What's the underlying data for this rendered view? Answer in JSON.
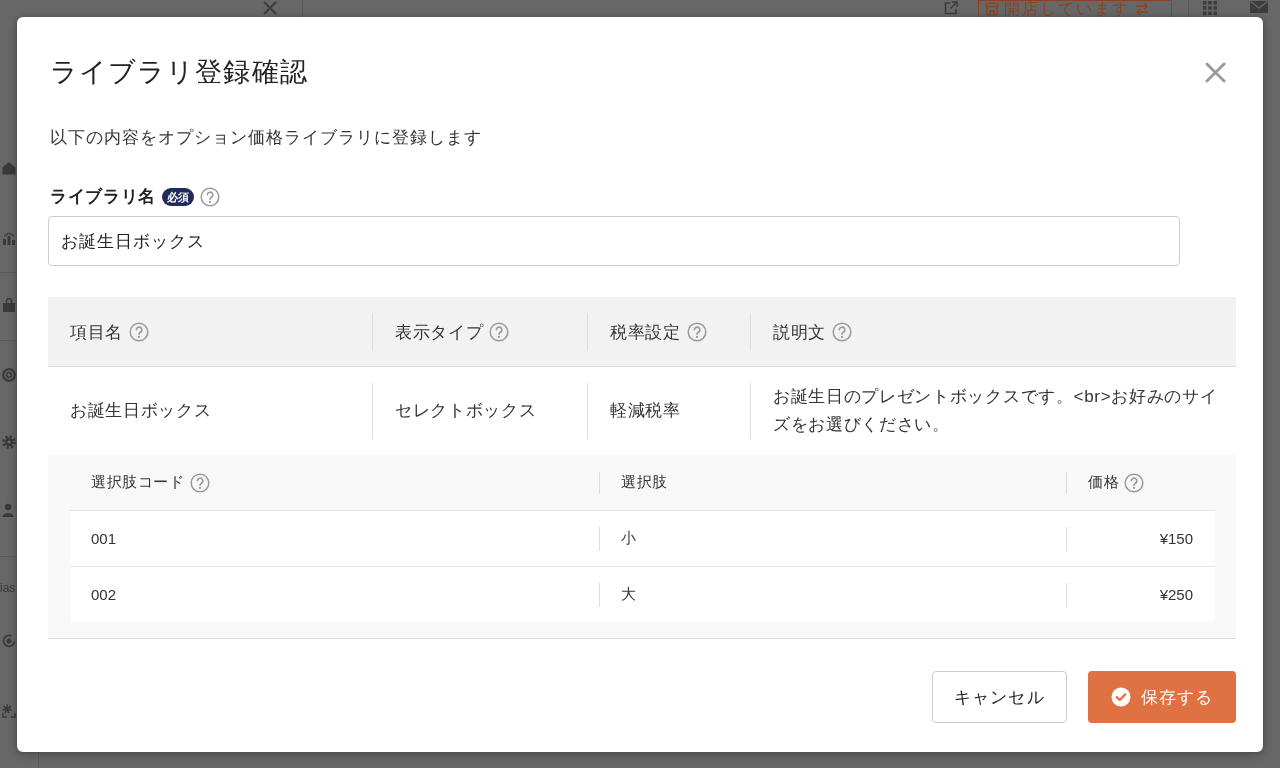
{
  "background_app": {
    "store_status_button": "開店しています",
    "sidebar_text": "ias"
  },
  "dialog": {
    "title": "ライブラリ登録確認",
    "description": "以下の内容をオプション価格ライブラリに登録します",
    "library_name_field": {
      "label": "ライブラリ名",
      "badge": "必須",
      "help": true,
      "value": "お誕生日ボックス"
    },
    "item_table": {
      "columns": [
        {
          "label": "項目名",
          "help": true
        },
        {
          "label": "表示タイプ",
          "help": true
        },
        {
          "label": "税率設定",
          "help": true
        },
        {
          "label": "説明文",
          "help": true
        }
      ],
      "rows": [
        [
          "お誕生日ボックス",
          "セレクトボックス",
          "軽減税率",
          "お誕生日のプレゼントボックスです。<br>お好みのサイズをお選びください。"
        ]
      ]
    },
    "options_table": {
      "columns": [
        {
          "label": "選択肢コード",
          "help": true,
          "kind": "text"
        },
        {
          "label": "選択肢",
          "help": false,
          "kind": "text"
        },
        {
          "label": "価格",
          "help": true,
          "kind": "price"
        }
      ],
      "rows": [
        [
          "001",
          "小",
          "¥150"
        ],
        [
          "002",
          "大",
          "¥250"
        ]
      ]
    },
    "buttons": [
      {
        "label": "キャンセル",
        "kind": "secondary"
      },
      {
        "label": "保存する",
        "kind": "primary"
      }
    ]
  }
}
